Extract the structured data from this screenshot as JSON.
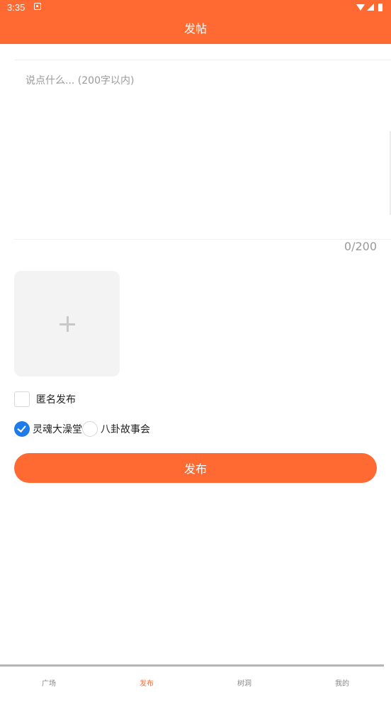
{
  "status_bar": {
    "time": "3:35"
  },
  "header": {
    "title": "发帖"
  },
  "post": {
    "placeholder": "说点什么... (200字以内)",
    "char_count": "0/200"
  },
  "options": {
    "anonymous_label": "匿名发布",
    "anonymous_checked": false,
    "categories": [
      {
        "label": "灵魂大澡堂",
        "selected": true
      },
      {
        "label": "八卦故事会",
        "selected": false
      }
    ]
  },
  "actions": {
    "publish_label": "发布"
  },
  "bottom_nav": {
    "items": [
      {
        "label": "广场",
        "active": false
      },
      {
        "label": "发布",
        "active": true
      },
      {
        "label": "树洞",
        "active": false
      },
      {
        "label": "我的",
        "active": false
      }
    ]
  },
  "colors": {
    "brand": "#FF6A33",
    "selected_radio": "#1E7BE8"
  },
  "icons": [
    "wifi-icon",
    "signal-icon",
    "battery-icon",
    "plus-icon",
    "checkmark-icon"
  ]
}
